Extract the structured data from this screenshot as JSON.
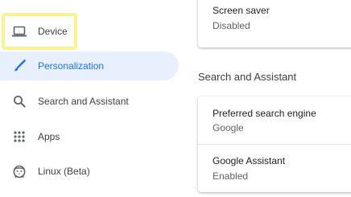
{
  "sidebar": {
    "items": [
      {
        "label": "Device",
        "icon": "laptop-icon"
      },
      {
        "label": "Personalization",
        "icon": "brush-icon",
        "selected": true
      },
      {
        "label": "Search and Assistant",
        "icon": "search-icon"
      },
      {
        "label": "Apps",
        "icon": "apps-grid-icon"
      },
      {
        "label": "Linux (Beta)",
        "icon": "linux-penguin-icon"
      }
    ]
  },
  "main": {
    "screen_saver": {
      "title": "Screen saver",
      "value": "Disabled"
    },
    "search_section": {
      "heading": "Search and Assistant",
      "preferred_engine": {
        "title": "Preferred search engine",
        "value": "Google"
      },
      "assistant": {
        "title": "Google Assistant",
        "value": "Enabled"
      }
    }
  },
  "colors": {
    "accent": "#1a73e8",
    "selected_bg": "#e8f0fe",
    "highlight": "#fdf38e",
    "text_primary": "#202124",
    "text_secondary": "#5f6368"
  }
}
